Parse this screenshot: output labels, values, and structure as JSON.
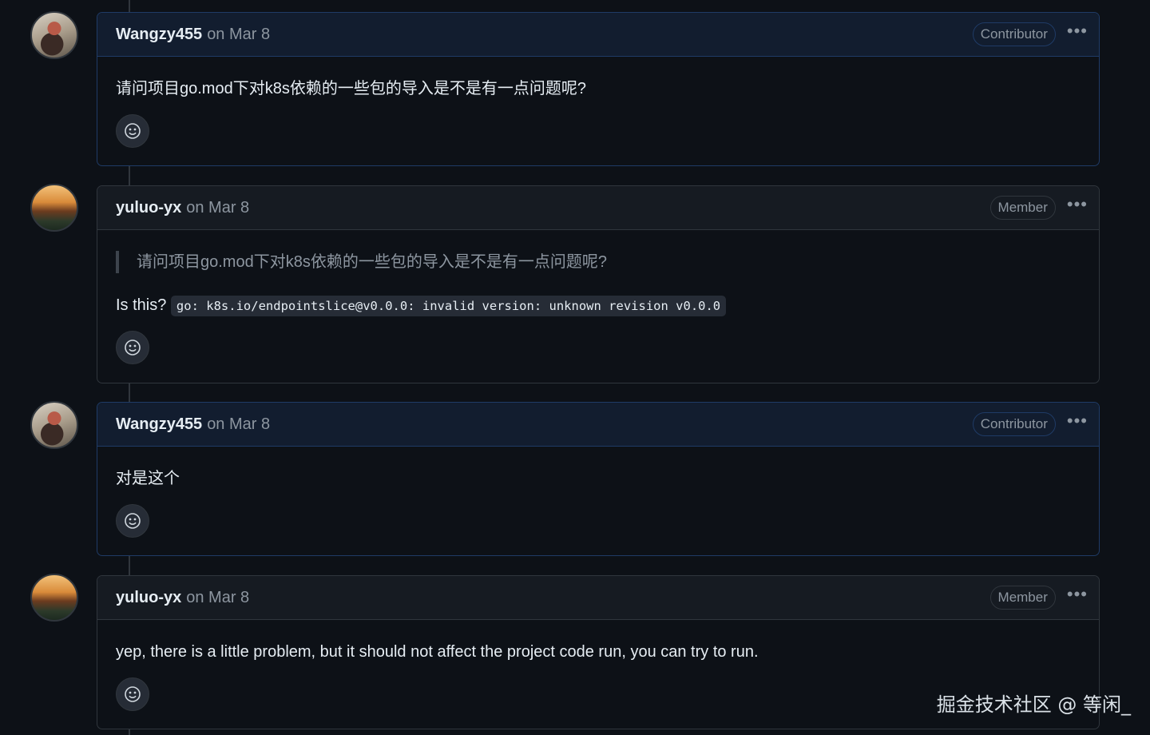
{
  "comments": [
    {
      "author": "Wangzy455",
      "date": "on Mar 8",
      "badge": "Contributor",
      "more": "•••",
      "text": "请问项目go.mod下对k8s依赖的一些包的导入是不是有一点问题呢?"
    },
    {
      "author": "yuluo-yx",
      "date": "on Mar 8",
      "badge": "Member",
      "more": "•••",
      "quote": "请问项目go.mod下对k8s依赖的一些包的导入是不是有一点问题呢?",
      "text": "Is this?",
      "code": "go: k8s.io/endpointslice@v0.0.0: invalid version: unknown revision v0.0.0"
    },
    {
      "author": "Wangzy455",
      "date": "on Mar 8",
      "badge": "Contributor",
      "more": "•••",
      "text": "对是这个"
    },
    {
      "author": "yuluo-yx",
      "date": "on Mar 8",
      "badge": "Member",
      "more": "•••",
      "text": "yep, there is a little problem, but it should not affect the project code run, you can try to run."
    }
  ],
  "watermark": "掘金技术社区 @ 等闲_",
  "icons": {
    "reaction": "smiley-icon",
    "more": "kebab-horizontal-icon"
  },
  "colors": {
    "background": "#0d1117",
    "header": "#161b22",
    "highlight_header": "#121d2f",
    "border": "#30363d",
    "muted": "#8d96a0"
  }
}
